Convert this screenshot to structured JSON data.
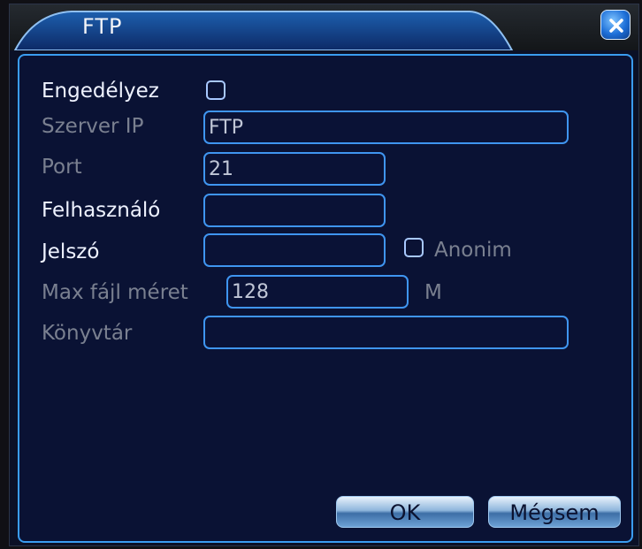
{
  "window": {
    "title": "FTP",
    "close_icon": "close-icon"
  },
  "form": {
    "enable": {
      "label": "Engedélyez",
      "checked": false
    },
    "server_ip": {
      "label": "Szerver IP",
      "value": "FTP"
    },
    "port": {
      "label": "Port",
      "value": "21"
    },
    "username": {
      "label": "Felhasználó",
      "value": ""
    },
    "password": {
      "label": "Jelszó",
      "value": ""
    },
    "anonymous": {
      "label": "Anonim",
      "checked": false
    },
    "max_file_size": {
      "label": "Max fájl méret",
      "value": "128",
      "unit": "M"
    },
    "directory": {
      "label": "Könyvtár",
      "value": ""
    }
  },
  "buttons": {
    "ok": "OK",
    "cancel": "Mégsem"
  },
  "colors": {
    "accent": "#3a9cf0",
    "panel": "#0a1234",
    "label_enabled": "#eef2ff",
    "label_disabled": "#7a8090"
  }
}
